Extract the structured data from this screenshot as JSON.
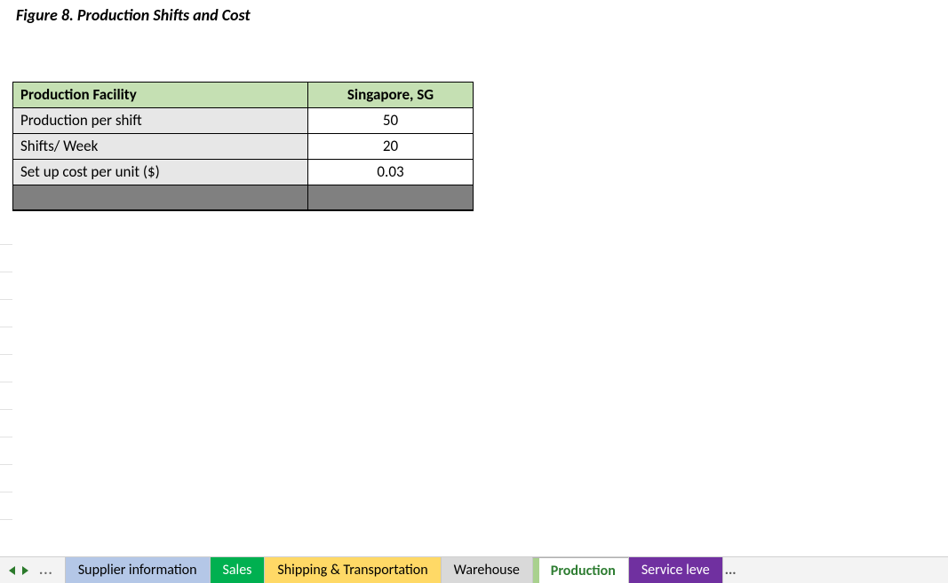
{
  "figure_title": "Figure 8. Production Shifts and Cost",
  "table": {
    "header": {
      "facility_label": "Production Facility",
      "location": "Singapore, SG"
    },
    "rows": [
      {
        "label": "Production per shift",
        "value": "50"
      },
      {
        "label": "Shifts/ Week",
        "value": "20"
      },
      {
        "label": "Set up cost per unit ($)",
        "value": "0.03"
      }
    ]
  },
  "tabs": {
    "nav_dots": "...",
    "items": [
      {
        "label": "Supplier information",
        "color": "#b4c7e7",
        "active": false
      },
      {
        "label": "Sales",
        "color": "#00b050",
        "active": false
      },
      {
        "label": "Shipping & Transportation",
        "color": "#ffd966",
        "active": false
      },
      {
        "label": "Warehouse",
        "color": "#d0cece",
        "active": false
      },
      {
        "label": "Production",
        "color": "#a9d18e",
        "active": true
      },
      {
        "label": "Service leve",
        "color": "#7030a0",
        "active": false,
        "text_color": "#ffffff"
      }
    ],
    "trailing_dots": "..."
  },
  "chart_data": {
    "type": "table",
    "title": "Figure 8. Production Shifts and Cost",
    "columns": [
      "Production Facility",
      "Singapore, SG"
    ],
    "rows": [
      [
        "Production per shift",
        50
      ],
      [
        "Shifts/ Week",
        20
      ],
      [
        "Set up cost per unit ($)",
        0.03
      ]
    ]
  }
}
